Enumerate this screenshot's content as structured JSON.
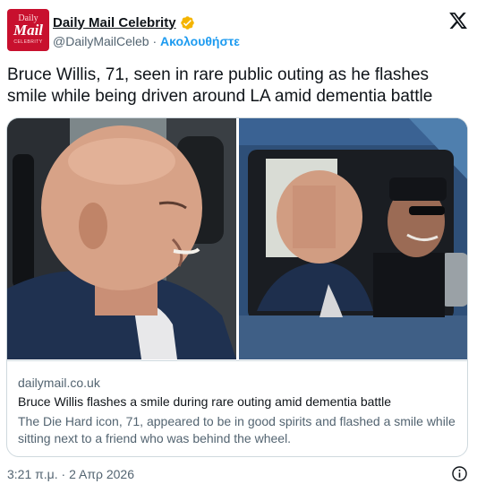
{
  "account": {
    "avatar_line1": "Daily",
    "avatar_line2": "Mail",
    "avatar_line3": "CELEBRITY",
    "display_name": "Daily Mail Celebrity",
    "handle": "@DailyMailCeleb",
    "separator": " · ",
    "follow_label": "Ακολουθήστε",
    "verified_badge_color": "#f4b400"
  },
  "tweet": {
    "text": "Bruce Willis, 71, seen in rare public outing as he flashes smile while being driven around LA amid dementia battle"
  },
  "card": {
    "domain": "dailymail.co.uk",
    "title": "Bruce Willis flashes a smile during rare outing amid dementia battle",
    "description": "The Die Hard icon, 71, appeared to be in good spirits and flashed a smile while sitting next to a friend who was behind the wheel."
  },
  "footer": {
    "timestamp": "3:21 π.μ. · 2 Απρ 2026"
  },
  "icons": {
    "x_logo": "x-logo-icon",
    "verified": "verified-badge-icon",
    "info": "info-icon"
  },
  "colors": {
    "accent": "#1d9bf0",
    "brand_red": "#c8102e",
    "text_primary": "#0f1419",
    "text_secondary": "#536471"
  }
}
